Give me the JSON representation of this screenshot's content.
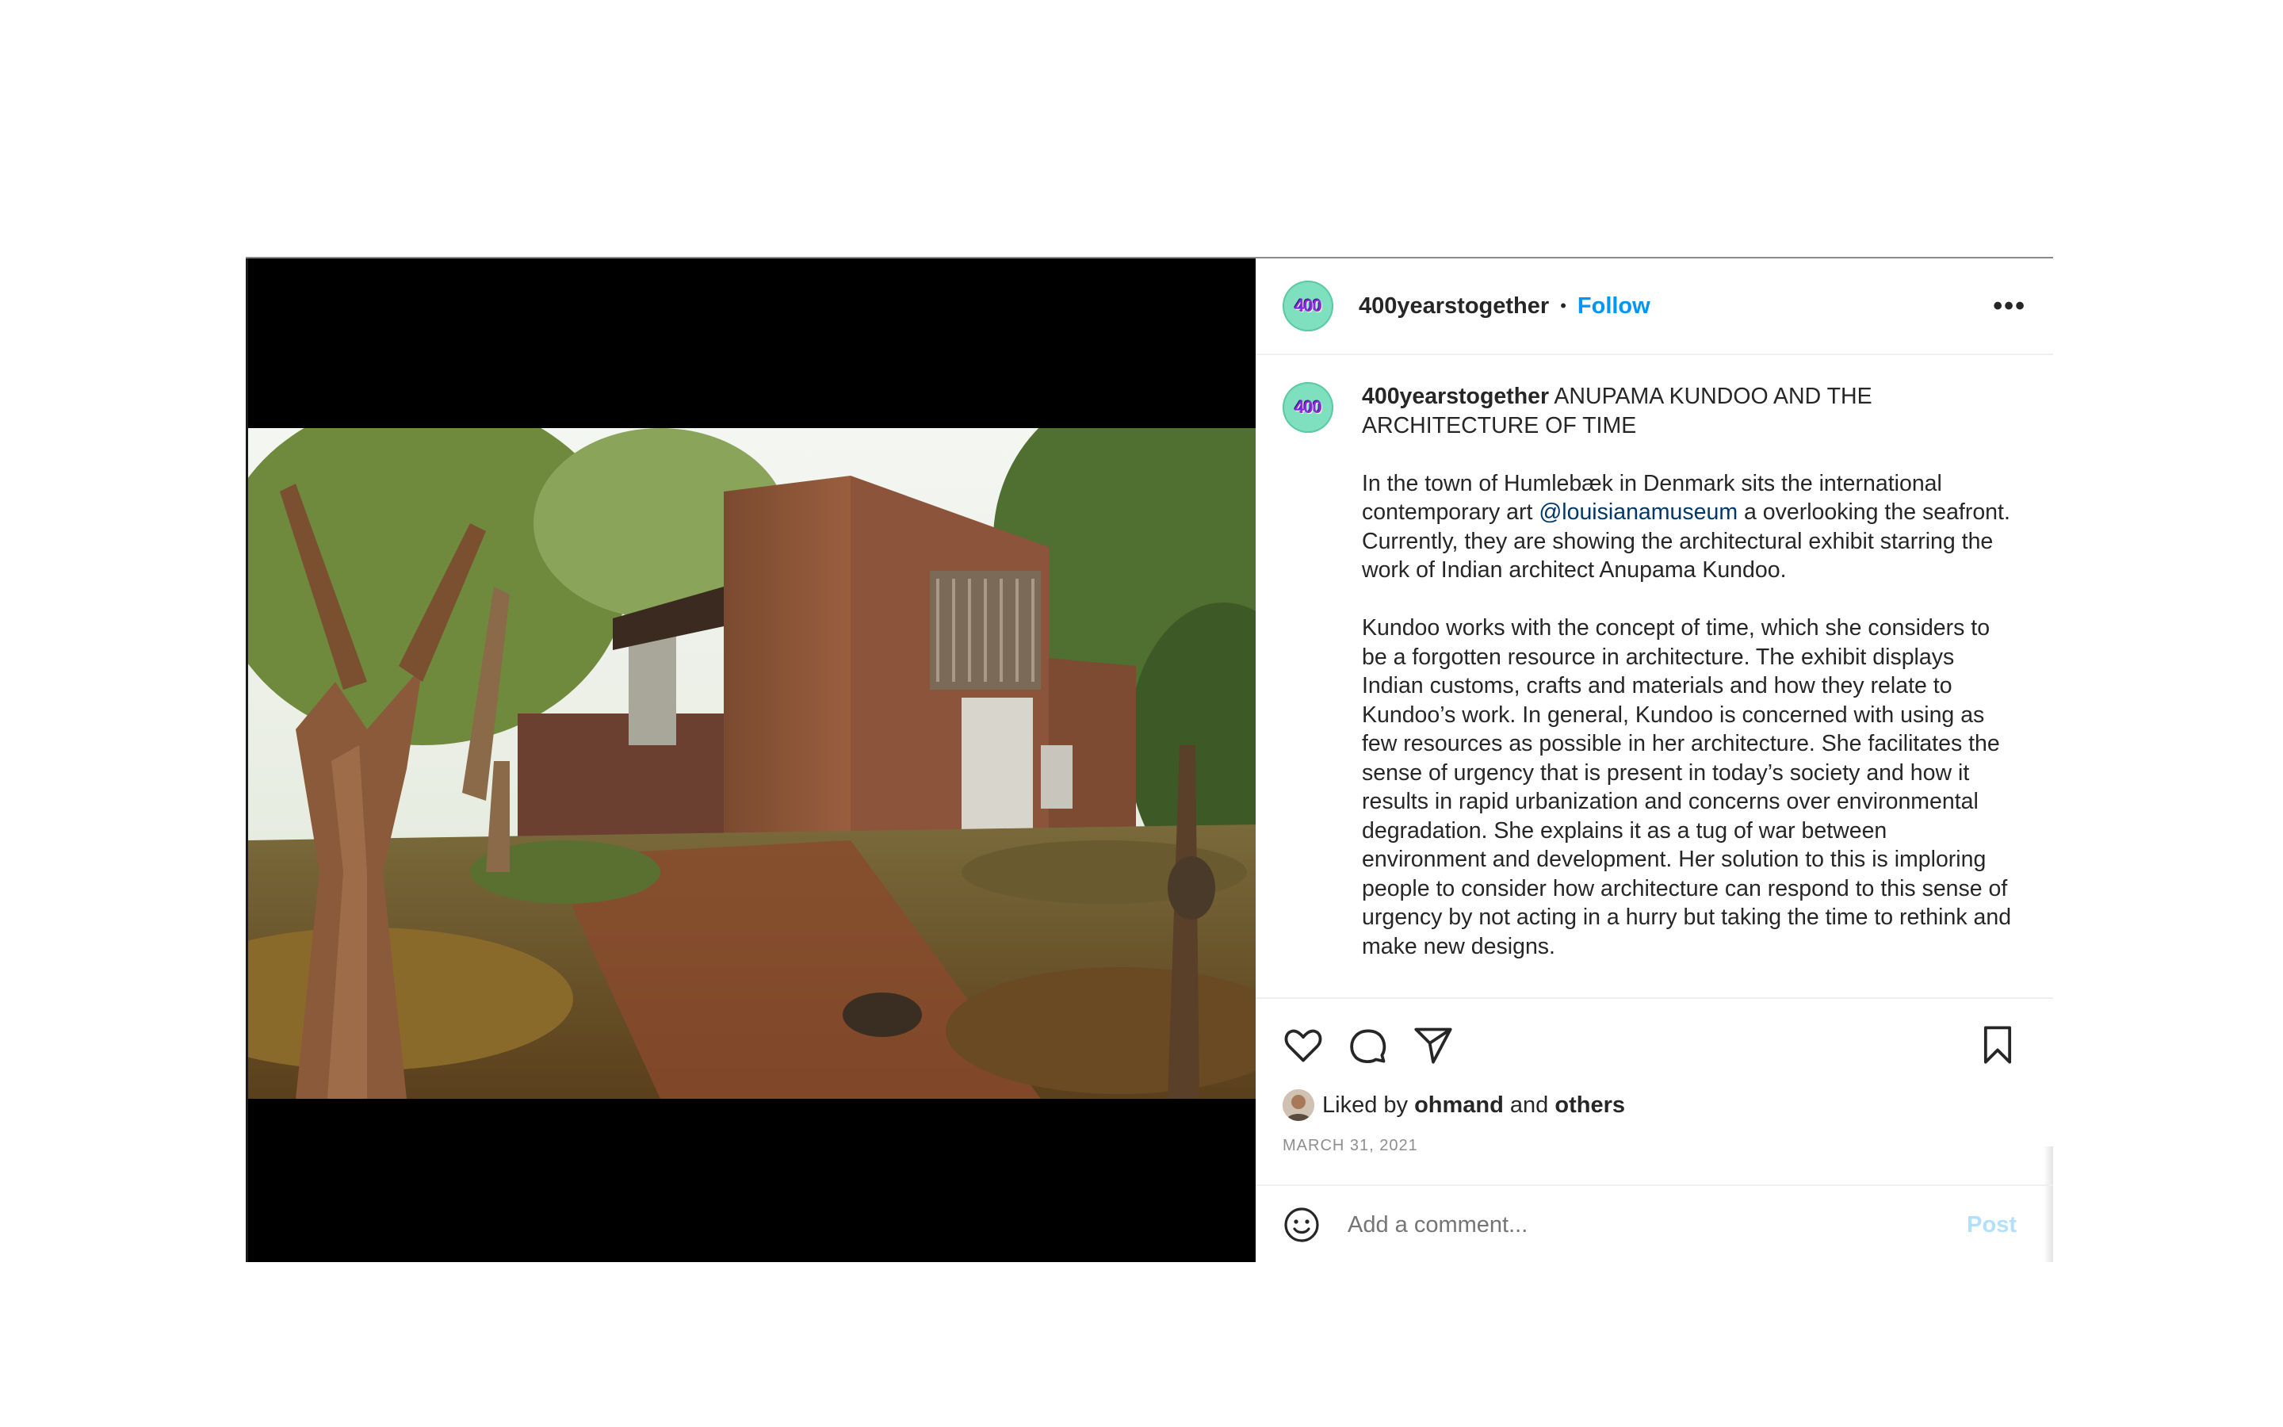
{
  "post": {
    "username": "400yearstogether",
    "avatar_text": "400",
    "follow_label": "Follow",
    "separator": "•",
    "more_label": "•••"
  },
  "caption": {
    "username": "400yearstogether",
    "title": "ANUPAMA KUNDOO AND THE ARCHITECTURE OF TIME",
    "p1_before": "In the town of Humlebæk in Denmark sits the international contemporary art",
    "p1_mention": "@louisianamuseum",
    "p1_after": "a overlooking the seafront. Currently, they are showing the architectural exhibit starring the work of Indian architect Anupama Kundoo.",
    "p2": "Kundoo works with the concept of time, which she considers to be a forgotten resource in architecture. The exhibit displays Indian customs, crafts and materials and how they relate to Kundoo’s work. In general, Kundoo is concerned with using as few resources as possible in her architecture. She facilitates the sense of urgency that is present in today’s society and how it results in rapid urbanization and concerns over environmental degradation. She explains it as a tug of war between environment and development. Her solution to this is imploring people to consider how architecture can respond to this sense of urgency by not acting in a hurry but taking the time to rethink and make new designs."
  },
  "likes": {
    "prefix": "Liked by",
    "user": "ohmand",
    "and": "and",
    "others": "others"
  },
  "date": "MARCH 31, 2021",
  "comment": {
    "placeholder": "Add a comment...",
    "post_label": "Post"
  },
  "icons": {
    "like": "heart-icon",
    "comment": "comment-icon",
    "share": "paper-plane-icon",
    "save": "bookmark-icon",
    "emoji": "smiley-icon"
  }
}
